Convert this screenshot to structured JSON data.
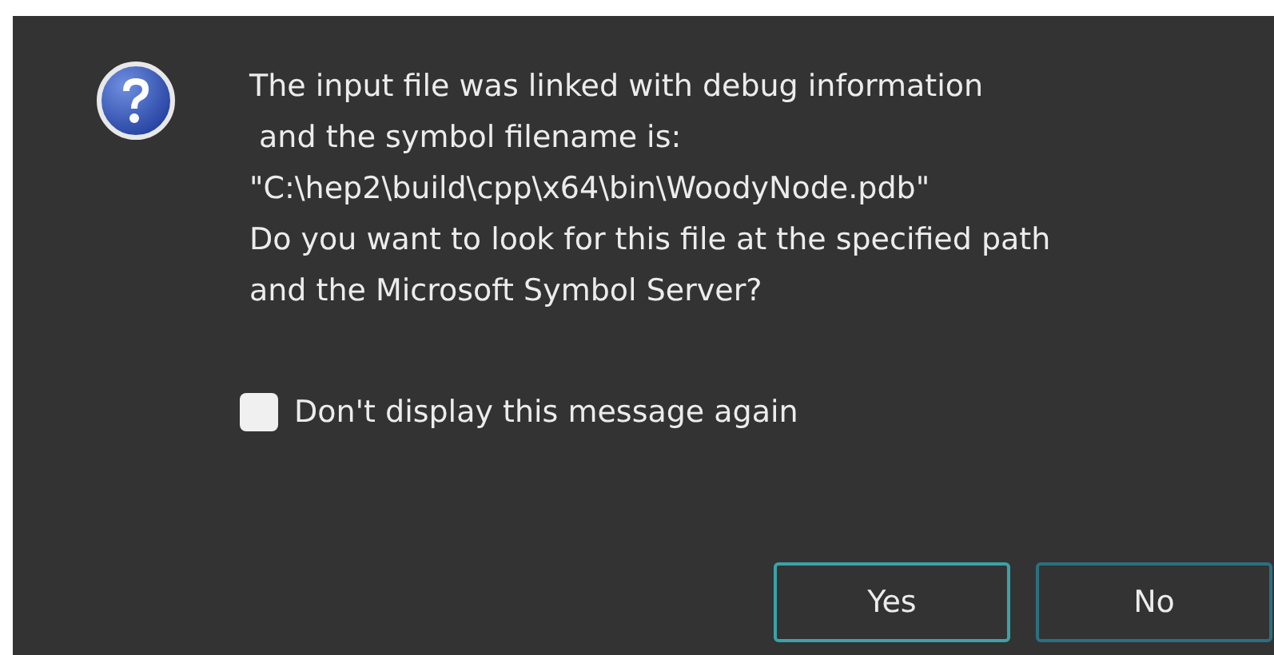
{
  "dialog": {
    "message": "The input file was linked with debug information\n and the symbol filename is:\n\"C:\\hep2\\build\\cpp\\x64\\bin\\WoodyNode.pdb\"\nDo you want to look for this file at the specified path\nand the Microsoft Symbol Server?",
    "checkbox": {
      "label": "Don't display this message again",
      "checked": false
    },
    "buttons": [
      {
        "label": "Yes",
        "selected": true
      },
      {
        "label": "No",
        "selected": false
      }
    ]
  }
}
